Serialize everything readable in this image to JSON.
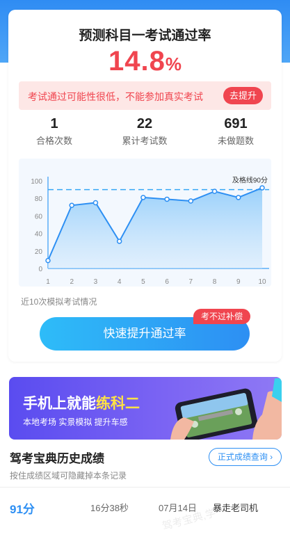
{
  "header": {
    "title": "预测科目一考试通过率",
    "rate_number": "14.8",
    "rate_unit": "%"
  },
  "warning": {
    "text": "考试通过可能性很低，不能参加真实考试",
    "button": "去提升"
  },
  "stats": [
    {
      "value": "1",
      "label": "合格次数"
    },
    {
      "value": "22",
      "label": "累计考试数"
    },
    {
      "value": "691",
      "label": "未做题数"
    }
  ],
  "chart_data": {
    "type": "area",
    "x": [
      1,
      2,
      3,
      4,
      5,
      6,
      7,
      8,
      9,
      10
    ],
    "values": [
      9,
      72,
      75,
      31,
      81,
      79,
      77,
      88,
      81,
      92
    ],
    "ylim": [
      0,
      100
    ],
    "yticks": [
      0,
      20,
      40,
      60,
      80,
      100
    ],
    "xticks": [
      "1",
      "2",
      "3",
      "4",
      "5",
      "6",
      "7",
      "8",
      "9",
      "10"
    ],
    "threshold": 90,
    "threshold_label": "及格线90分",
    "line_color": "#2d8ff3",
    "threshold_color": "#37a7f5",
    "grid": false
  },
  "chart_caption": "近10次模拟考试情况",
  "cta": {
    "label": "快速提升通过率",
    "badge": "考不过补偿"
  },
  "banner": {
    "title_prefix": "手机上就能",
    "title_highlight": "练科二",
    "subtitle": "本地考场  实景模拟  提升车感"
  },
  "history": {
    "title": "驾考宝典历史成绩",
    "subtitle": "按住成绩区域可隐藏掉本条记录",
    "button": "正式成绩查询",
    "rows": [
      {
        "score": "91分",
        "duration": "16分38秒",
        "date": "07月14日",
        "rank": "暴走老司机"
      }
    ]
  },
  "watermark": "驾考宝典,学",
  "colors": {
    "accent": "#2d8ff3",
    "danger": "#f0454f",
    "banner": "#6a57f2",
    "highlight": "#ffe245"
  }
}
